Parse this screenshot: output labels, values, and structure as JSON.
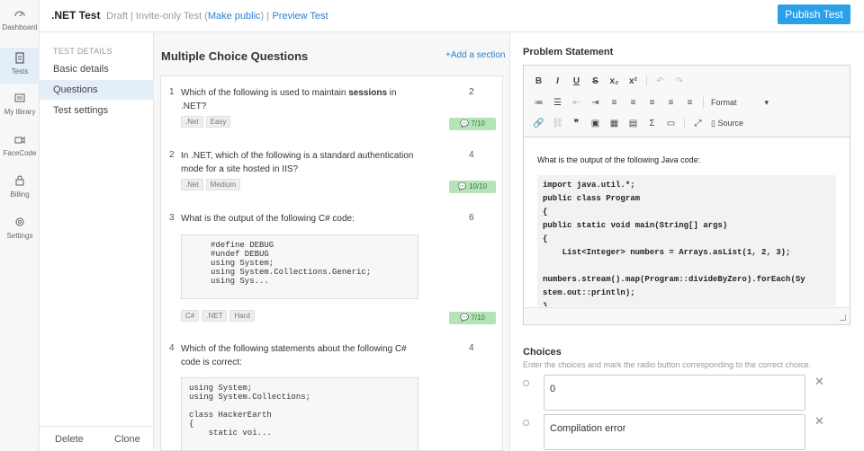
{
  "nav": [
    {
      "label": "Dashboard",
      "icon": "dashboard-icon"
    },
    {
      "label": "Tests",
      "icon": "clipboard-icon"
    },
    {
      "label": "My library",
      "icon": "library-icon"
    },
    {
      "label": "FaceCode",
      "icon": "video-camera-icon"
    },
    {
      "label": "Billing",
      "icon": "lock-icon"
    },
    {
      "label": "Settings",
      "icon": "gear-icon"
    }
  ],
  "header": {
    "test_name": ".NET Test",
    "status": "Draft | Invite-only Test (",
    "make_public": "Make public",
    "sep": ") |",
    "preview": "Preview Test",
    "publish": "Publish Test"
  },
  "sidebar": {
    "heading": "TEST DETAILS",
    "items": [
      "Basic details",
      "Questions",
      "Test settings"
    ],
    "delete": "Delete",
    "clone": "Clone"
  },
  "mcq": {
    "title": "Multiple Choice Questions",
    "add_section": "+Add a section",
    "questions": [
      {
        "num": "1",
        "text_a": "Which of the following is used to maintain ",
        "text_b": "sessions",
        "text_c": " in .NET?",
        "marks": "2",
        "tags": [
          ".Net",
          "Easy"
        ],
        "score": "7/10"
      },
      {
        "num": "2",
        "text": "In .NET, which of the following is a standard authentication mode for a site hosted in IIS?",
        "marks": "4",
        "tags": [
          ".Net",
          "Medium"
        ],
        "score": "10/10"
      },
      {
        "num": "3",
        "text": "What is the output of the following C# code:",
        "marks": "6",
        "code": "#define DEBUG\n#undef DEBUG\nusing System;\nusing System.Collections.Generic;\nusing Sys...",
        "tags": [
          "C#",
          ".NET",
          "Hard"
        ],
        "score": "7/10"
      },
      {
        "num": "4",
        "text": "Which of the following statements about the following C# code is correct:",
        "marks": "4",
        "code": "using System;\nusing System.Collections;\n\nclass HackerEarth\n{\n    static voi..."
      }
    ]
  },
  "problem": {
    "title": "Problem Statement",
    "format_label": "Format",
    "source_label": "Source",
    "intro": "What is the output of the following Java code:",
    "code": "import java.util.*;\npublic class Program\n{\npublic static void main(String[] args)\n{\n    List<Integer> numbers = Arrays.asList(1, 2, 3);\n\nnumbers.stream().map(Program::divideByZero).forEach(Sy\nstem.out::println);\n}"
  },
  "choices": {
    "title": "Choices",
    "hint": "Enter the choices and mark the radio button corresponding to the correct choice.",
    "items": [
      "0",
      "Compilation error"
    ]
  },
  "colors": {
    "accent": "#2b9fe8",
    "badge": "#b5e3b8",
    "active": "#e3eef8"
  }
}
